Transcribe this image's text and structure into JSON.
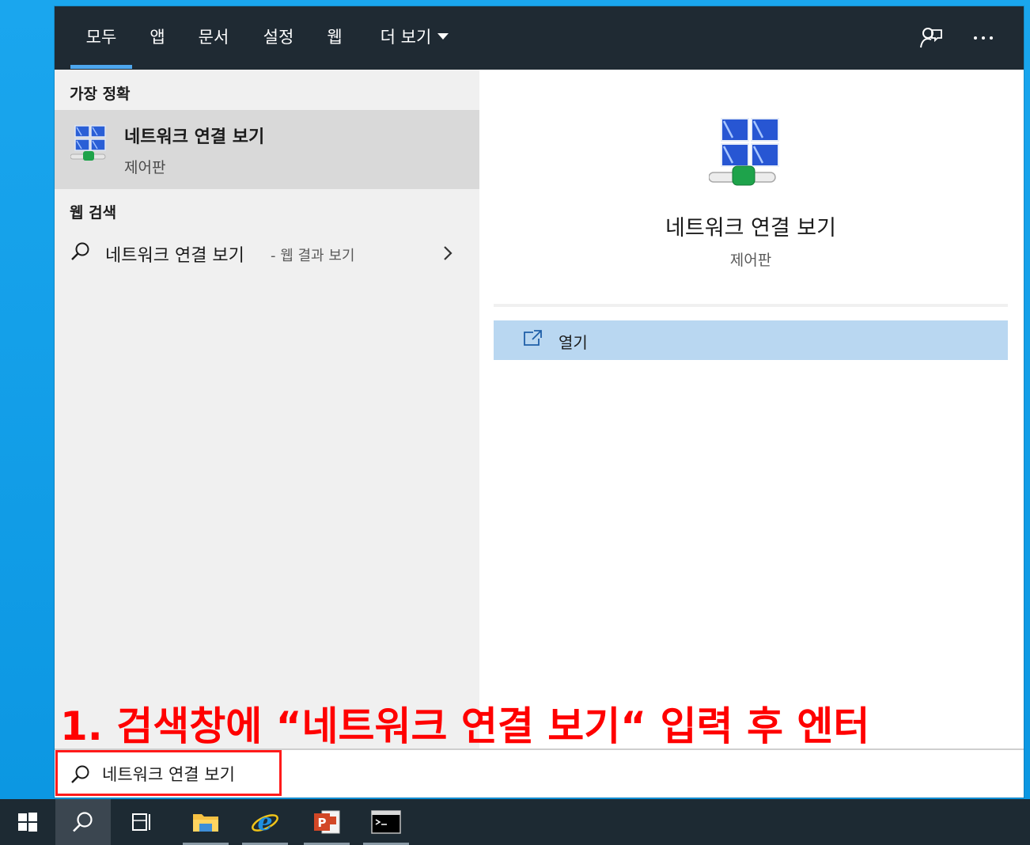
{
  "tabs": [
    {
      "label": "모두",
      "active": true
    },
    {
      "label": "앱"
    },
    {
      "label": "문서"
    },
    {
      "label": "설정"
    },
    {
      "label": "웹"
    },
    {
      "label": "더 보기"
    }
  ],
  "top_actions": {
    "feedback_icon": "feedback-icon",
    "more_icon": "more-options-icon"
  },
  "best_match": {
    "section_title": "가장 정확",
    "title": "네트워크 연결 보기",
    "subtitle": "제어판",
    "icon": "network-connections-icon"
  },
  "web_search": {
    "section_title": "웹 검색",
    "query": "네트워크 연결 보기",
    "suffix": "- 웹 결과 보기"
  },
  "preview": {
    "title": "네트워크 연결 보기",
    "subtitle": "제어판",
    "actions": [
      {
        "label": "열기",
        "icon": "open-icon"
      }
    ]
  },
  "annotation": {
    "text": "1. 검색창에 “네트워크 연결 보기“ 입력 후 엔터",
    "color": "#ff0000"
  },
  "search_box": {
    "value": "네트워크 연결 보기"
  },
  "taskbar": {
    "items": [
      "start-icon",
      "search-icon",
      "task-view-icon",
      "file-explorer-icon",
      "internet-explorer-icon",
      "powerpoint-icon",
      "command-prompt-icon"
    ]
  },
  "colors": {
    "tab_bar": "#1f2a33",
    "accent": "#4ea7ee",
    "selected_row": "#d9d9d9",
    "action_highlight": "#b9d7f1"
  }
}
